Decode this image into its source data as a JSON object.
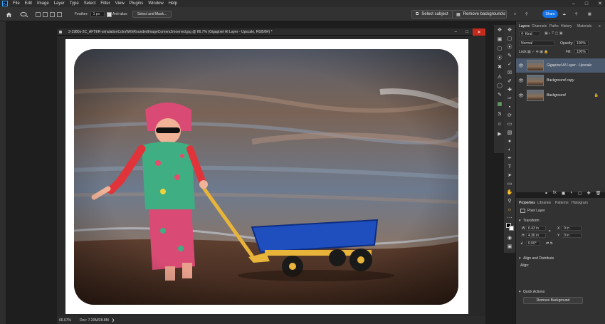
{
  "menubar": {
    "logo": "Ps",
    "items": [
      "File",
      "Edit",
      "Image",
      "Layer",
      "Type",
      "Select",
      "Filter",
      "View",
      "Plugins",
      "Window",
      "Help"
    ]
  },
  "options": {
    "feather_label": "Feather:",
    "feather_value": "1 px",
    "antialias_label": "Anti-alias",
    "select_mask_label": "Select and Mask...",
    "select_subject_label": "Select subject",
    "remove_background_label": "Remove background",
    "share_label": "Share"
  },
  "document": {
    "title": "3-1980s-2C_AFTER-simulationColorWithRoundedImageCorners2moerred.jpg @ 66.7% (Gigapixel AI Layer - Upscale, RGB/8#) *",
    "zoom": "66.67%",
    "doc_info": "Doc: 7.20M/28.8M"
  },
  "layers": {
    "tabs": [
      "Layers",
      "Channels",
      "Paths",
      "History",
      "Materials"
    ],
    "kind_label": "Kind",
    "blend_mode": "Normal",
    "opacity_label": "Opacity:",
    "opacity_value": "100%",
    "lock_label": "Lock:",
    "fill_label": "Fill:",
    "fill_value": "100%",
    "items": [
      {
        "name": "Gigapixel AI Layer - Upscale"
      },
      {
        "name": "Background copy"
      },
      {
        "name": "Background"
      }
    ]
  },
  "properties": {
    "tabs": [
      "Properties",
      "Libraries",
      "Patterns",
      "Histogram"
    ],
    "layer_type": "Pixel Layer",
    "transform_label": "Transform",
    "w_label": "W",
    "w_value": "6.43 in",
    "h_label": "H",
    "h_value": "4.36 in",
    "x_label": "X",
    "x_value": "0 in",
    "y_label": "Y",
    "y_value": "0 in",
    "angle_value": "0.00°",
    "align_label": "Align and Distribute",
    "align_sub": "Align:",
    "quick_actions_label": "Quick Actions",
    "remove_bg_label": "Remove Background"
  },
  "colors": {
    "accent": "#1473e6",
    "selected_layer": "#4b5a6e"
  }
}
